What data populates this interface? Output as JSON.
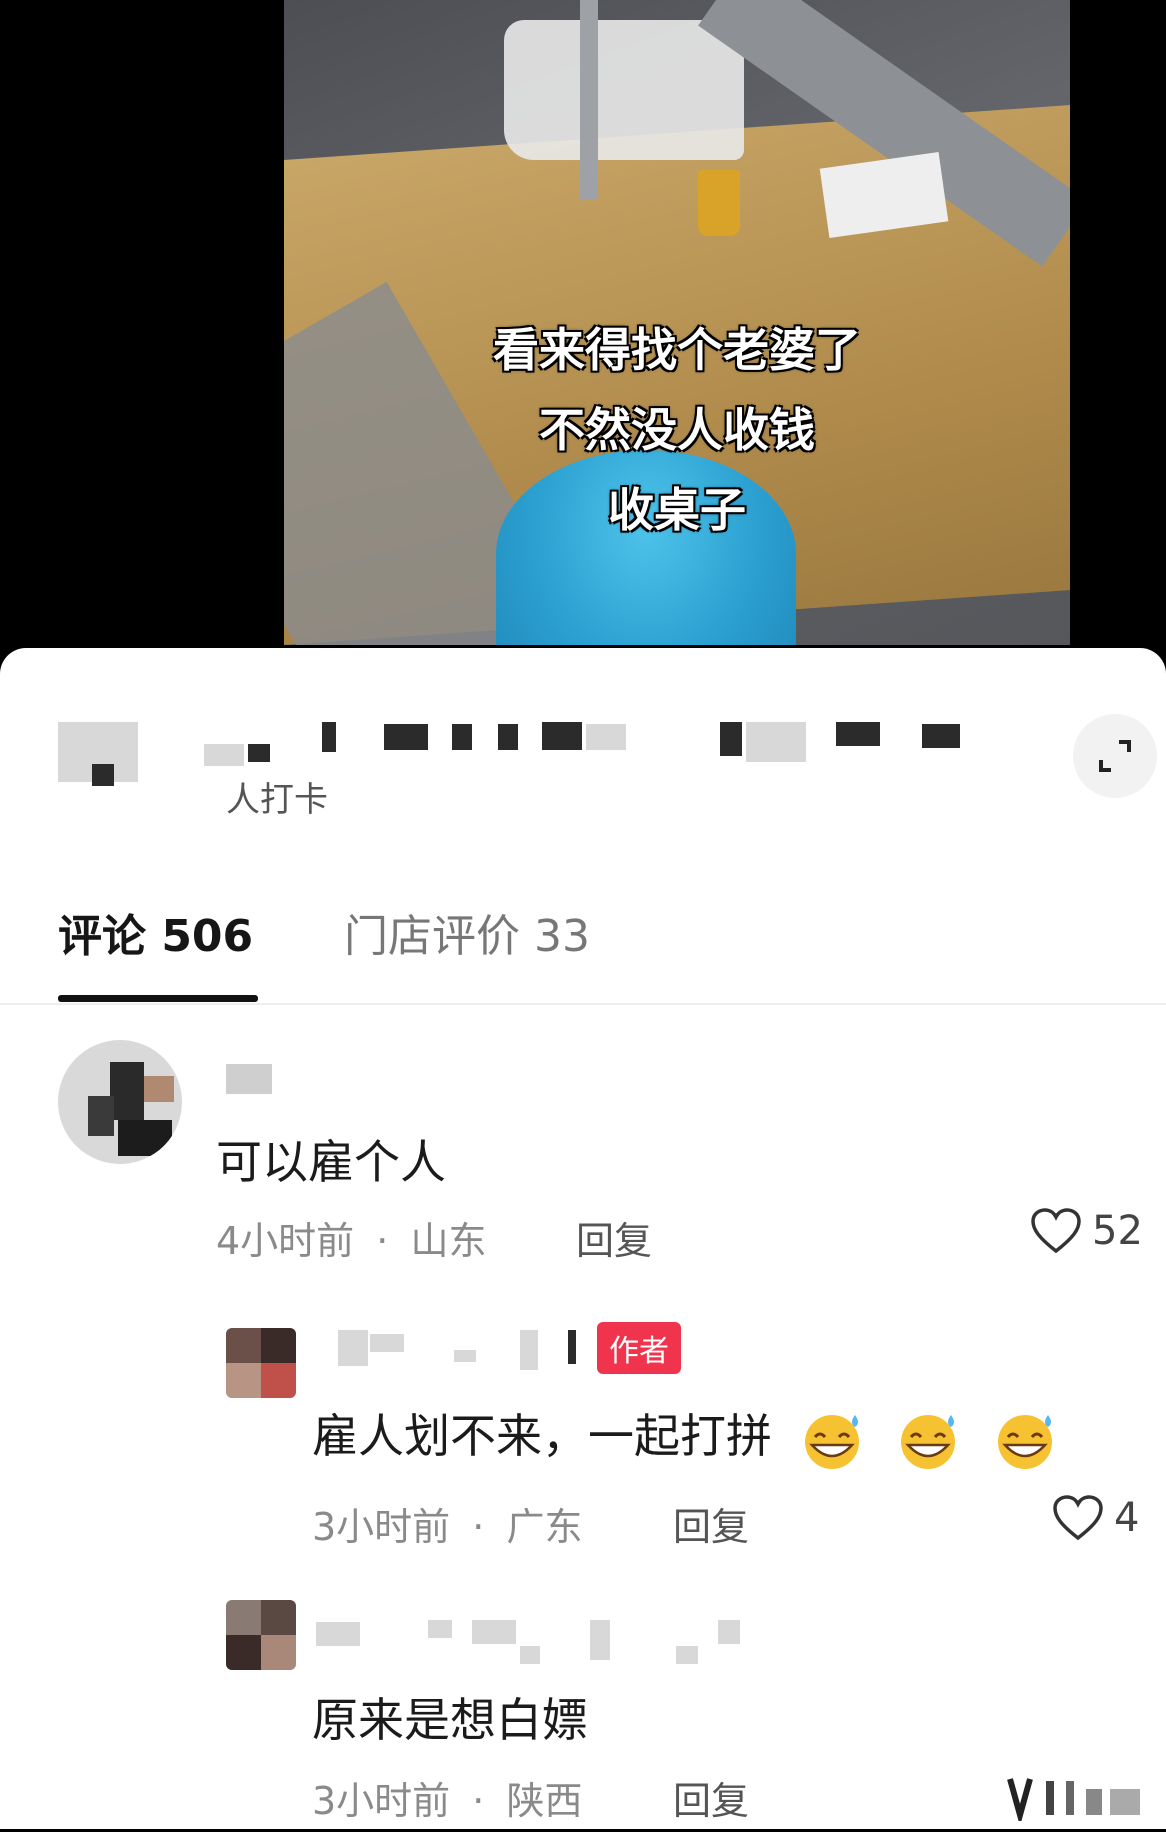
{
  "video": {
    "caption_lines": [
      "看来得找个老婆了",
      "不然没人收钱",
      "收桌子"
    ]
  },
  "shop": {
    "checkin_text": "人打卡"
  },
  "tabs": [
    {
      "label": "评论 506"
    },
    {
      "label": "门店评价 33"
    }
  ],
  "comments": [
    {
      "text": "可以雇个人",
      "time": "4小时前",
      "location": "山东",
      "reply_label": "回复",
      "likes": "52"
    },
    {
      "badge": "作者",
      "text": "雇人划不来，一起打拼",
      "emoji": [
        "cold-sweat-grin-emoji",
        "cold-sweat-grin-emoji",
        "cold-sweat-grin-emoji"
      ],
      "time": "3小时前",
      "location": "广东",
      "reply_label": "回复",
      "likes": "4"
    },
    {
      "text": "原来是想白嫖",
      "time": "3小时前",
      "location": "陕西",
      "reply_label": "回复"
    }
  ],
  "meta_separator": "·",
  "colors": {
    "author_badge": "#f0344d",
    "stool": "#2a9fd0",
    "sheet": "#ffffff"
  }
}
